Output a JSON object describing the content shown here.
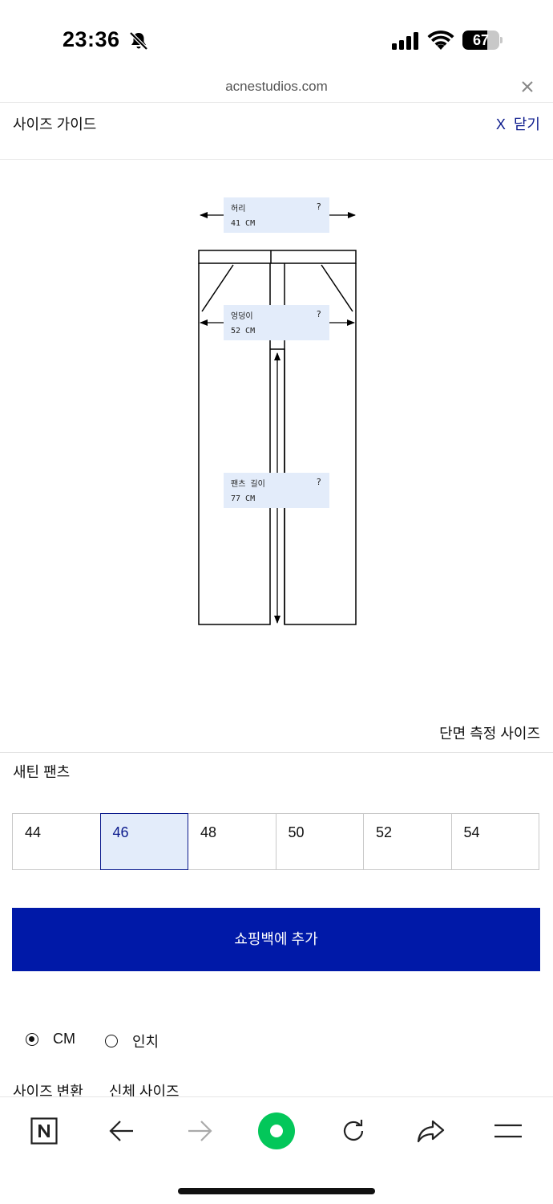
{
  "status_bar": {
    "time": "23:36",
    "battery": "67",
    "battery_level": 0.67
  },
  "url_bar": {
    "domain": "acnestudios.com"
  },
  "header": {
    "title": "사이즈 가이드",
    "close_x": "X",
    "close_label": "닫기"
  },
  "measurements": [
    {
      "name": "허리",
      "help": "?",
      "value": "41 CM"
    },
    {
      "name": "엉덩이",
      "help": "?",
      "value": "52 CM"
    },
    {
      "name": "팬츠 길이",
      "help": "?",
      "value": "77 CM"
    }
  ],
  "section_label": "단면 측정 사이즈",
  "product_name": "새틴 팬츠",
  "sizes": [
    "44",
    "46",
    "48",
    "50",
    "52",
    "54"
  ],
  "selected_size": "46",
  "add_to_bag": "쇼핑백에 추가",
  "units": [
    {
      "label": "CM",
      "selected": true
    },
    {
      "label": "인치",
      "selected": false
    }
  ],
  "bottom_tabs": [
    "사이즈 변환",
    "신체 사이즈"
  ],
  "colors": {
    "accent": "#0019a8",
    "highlight": "#e3ecfa",
    "link": "#0b1a8c",
    "toolbar_green": "#03c75a"
  }
}
